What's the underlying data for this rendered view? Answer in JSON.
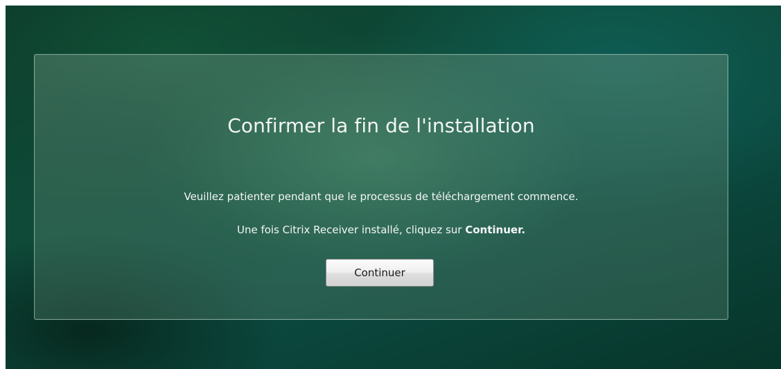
{
  "dialog": {
    "title": "Confirmer la fin de l'installation",
    "message_wait": "Veuillez patienter pendant que le processus de téléchargement commence.",
    "message_instruction_prefix": "Une fois Citrix Receiver installé, cliquez sur ",
    "message_instruction_emphasis": "Continuer",
    "message_instruction_suffix": ".",
    "continue_label": "Continuer"
  },
  "colors": {
    "background_dark_green": "#0d3f2c",
    "background_teal": "#0e6058",
    "dialog_panel": "#5a8a73",
    "text": "#f2f6f3",
    "button_face": "#eeeeee",
    "button_text": "#1a1a1a"
  }
}
